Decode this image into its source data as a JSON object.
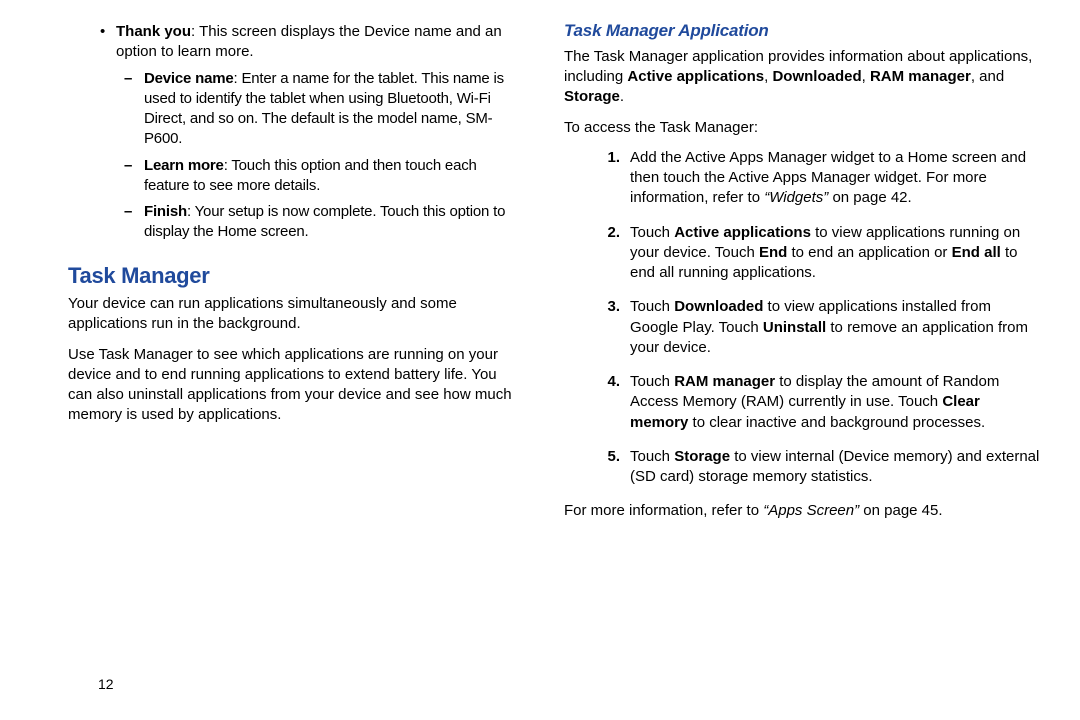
{
  "left": {
    "thank_you_bold": "Thank you",
    "thank_you_rest": ": This screen displays the Device name and an option to learn more.",
    "device_name_bold": "Device name",
    "device_name_rest": ": Enter a name for the tablet. This name is used to identify the tablet when using Bluetooth, Wi-Fi Direct, and so on. The default is the model name, SM-P600.",
    "learn_more_bold": "Learn more",
    "learn_more_rest": ": Touch this option and then touch each feature to see more details.",
    "finish_bold": "Finish",
    "finish_rest": ": Your setup is now complete. Touch this option to display the Home screen.",
    "section_title": "Task Manager",
    "para1": "Your device can run applications simultaneously and some applications run in the background.",
    "para2": "Use Task Manager to see which applications are running on your device and to end running applications to extend battery life. You can also uninstall applications from your device and see how much memory is used by applications."
  },
  "right": {
    "subsection_title": "Task Manager Application",
    "intro_pre": "The Task Manager application provides information about applications, including ",
    "intro_b1": "Active applications",
    "intro_s1": ", ",
    "intro_b2": "Downloaded",
    "intro_s2": ", ",
    "intro_b3": "RAM manager",
    "intro_s3": ", and ",
    "intro_b4": "Storage",
    "intro_s4": ".",
    "access_line": "To access the Task Manager:",
    "n1_pre": "Add the Active Apps Manager widget to a Home screen and then touch the Active Apps Manager widget. For more information, refer to ",
    "n1_ital": "“Widgets”",
    "n1_post": " on page 42.",
    "n2_pre": "Touch ",
    "n2_b1": "Active applications",
    "n2_mid1": " to view applications running on your device. Touch ",
    "n2_b2": "End",
    "n2_mid2": " to end an application or ",
    "n2_b3": "End all",
    "n2_post": " to end all running applications.",
    "n3_pre": "Touch ",
    "n3_b1": "Downloaded",
    "n3_mid1": " to view applications installed from Google Play. Touch ",
    "n3_b2": "Uninstall",
    "n3_post": " to remove an application from your device.",
    "n4_pre": "Touch ",
    "n4_b1": "RAM manager",
    "n4_mid1": " to display the amount of Random Access Memory (RAM) currently in use. Touch ",
    "n4_b2": "Clear memory",
    "n4_post": " to clear inactive and background processes.",
    "n5_pre": "Touch ",
    "n5_b1": "Storage",
    "n5_post": " to view internal (Device memory) and external (SD card) storage memory statistics.",
    "footer_pre": "For more information, refer to ",
    "footer_ital": "“Apps Screen”",
    "footer_post": " on page 45."
  },
  "labels": {
    "n1": "1.",
    "n2": "2.",
    "n3": "3.",
    "n4": "4.",
    "n5": "5."
  },
  "page_number": "12"
}
